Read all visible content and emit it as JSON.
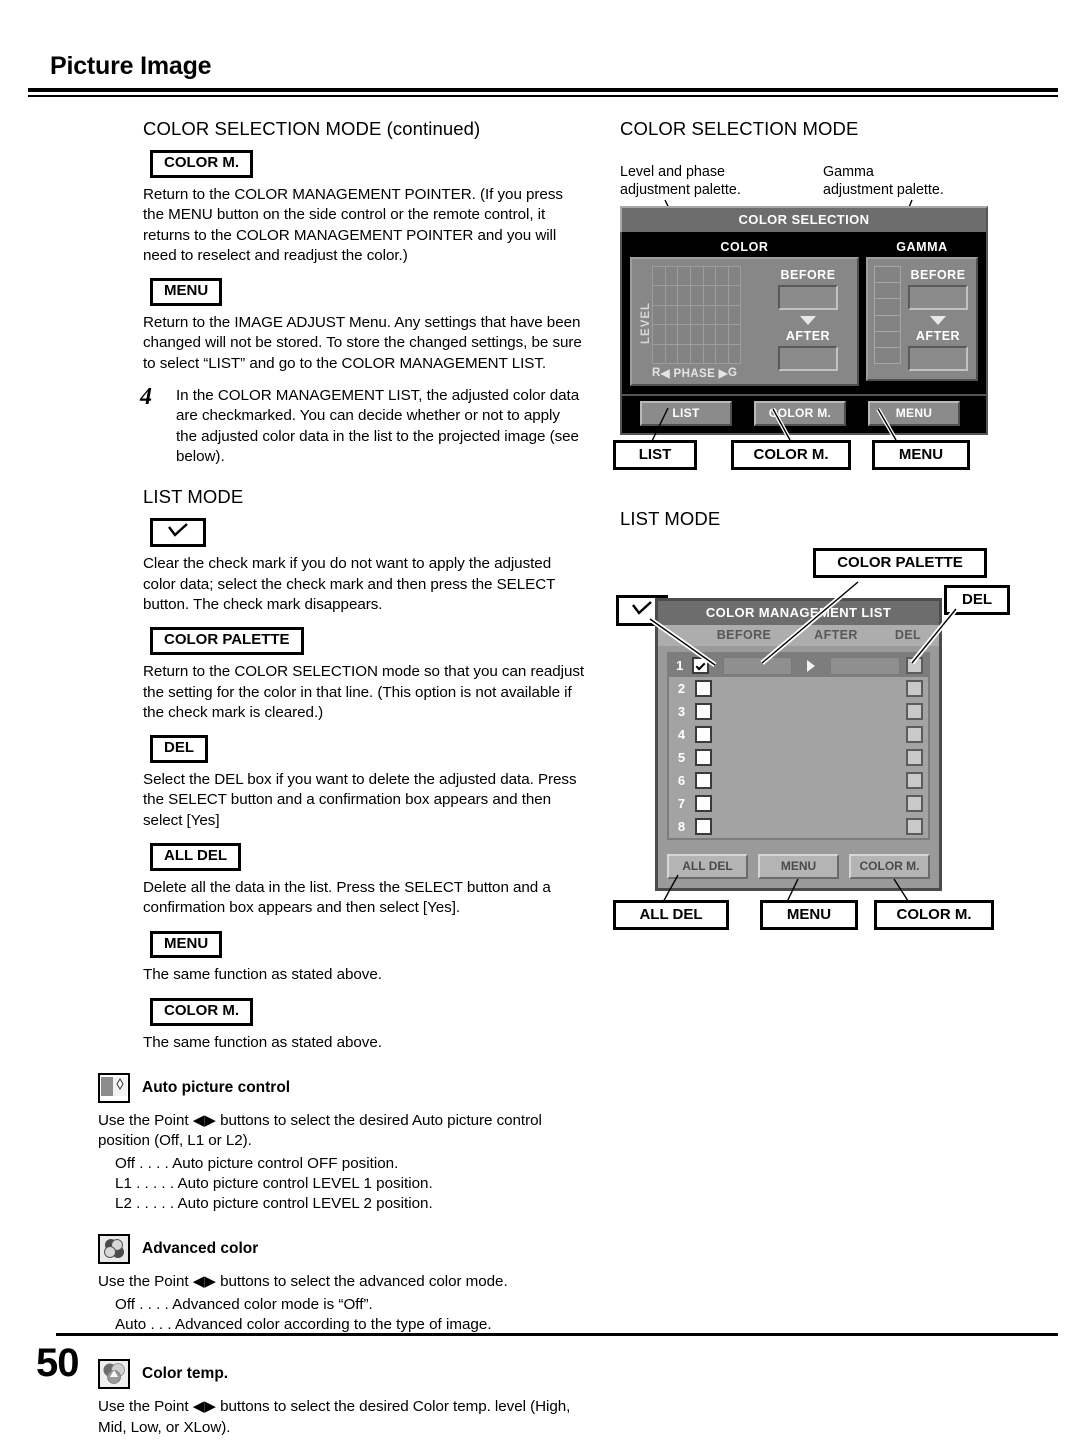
{
  "header": {
    "title": "Picture Image"
  },
  "footer": {
    "page_number": "50"
  },
  "left": {
    "section1_title": "COLOR SELECTION MODE (continued)",
    "color_m_label": "COLOR M.",
    "color_m_text": "Return to the COLOR MANAGEMENT POINTER. (If you press the MENU button on the side control or the remote control, it returns to the COLOR MANAGEMENT POINTER and you will need to reselect and readjust the color.)",
    "menu_label": "MENU",
    "menu_text": "Return to the IMAGE ADJUST Menu. Any settings that have been changed will not be stored. To store the changed settings, be sure to select “LIST” and go to the COLOR MANAGEMENT LIST.",
    "step_number": "4",
    "step_text": "In the COLOR MANAGEMENT LIST, the adjusted color data are checkmarked. You can decide whether or not to apply the adjusted color data in the list to the projected image (see below).",
    "list_mode_title": "LIST MODE",
    "check_label": "check-mark",
    "check_text": "Clear the check mark if you do not want to apply the adjusted color data; select the check mark and then press the SELECT button. The check mark disappears.",
    "color_palette_label": "COLOR PALETTE",
    "color_palette_text": "Return to the COLOR SELECTION mode so that you can readjust the setting for the color in that line. (This option is not available if the check mark is cleared.)",
    "del_label": "DEL",
    "del_text": "Select the DEL box if you want to delete the adjusted data. Press the SELECT button and a confirmation box appears and then select [Yes]",
    "all_del_label": "ALL DEL",
    "all_del_text": "Delete all the data in the list. Press the SELECT button and a confirmation box appears and then select [Yes].",
    "menu2_label": "MENU",
    "menu2_text": "The same function as stated above.",
    "color_m2_label": "COLOR M.",
    "color_m2_text": "The same function as stated above.",
    "features": [
      {
        "icon": "auto-picture-control-icon",
        "title": "Auto picture control",
        "text": "Use the Point ◀▶ buttons to select the desired Auto picture control position (Off, L1 or L2).",
        "options": [
          "Off  . . . .  Auto picture control OFF position.",
          "L1 . . . . .  Auto picture control LEVEL 1 position.",
          "L2 . . . . .  Auto picture control LEVEL 2 position."
        ]
      },
      {
        "icon": "advanced-color-icon",
        "title": "Advanced color",
        "text": "Use the Point ◀▶ buttons to select the advanced color mode.",
        "options": [
          "Off  . . . .  Advanced color mode is “Off”.",
          "Auto . . .  Advanced color according to the type of image."
        ]
      },
      {
        "icon": "color-temp-icon",
        "title": "Color temp.",
        "text": "Use the Point ◀▶ buttons to select the desired Color temp. level (High, Mid, Low, or XLow).",
        "options": []
      }
    ]
  },
  "right": {
    "section1_title": "COLOR SELECTION MODE",
    "annotation_left": "Level and phase\nadjustment palette.",
    "annotation_right": "Gamma\nadjustment palette.",
    "osd_color_selection": {
      "title": "COLOR SELECTION",
      "color_panel_label": "COLOR",
      "gamma_panel_label": "GAMMA",
      "level_axis_label": "LEVEL",
      "phase_axis_left": "R",
      "phase_axis_center": "◀ PHASE ▶",
      "phase_axis_right": "G",
      "before_label": "BEFORE",
      "after_label": "AFTER",
      "grid_cols": 7,
      "grid_rows": 5,
      "gamma_cells": 6,
      "buttons": [
        "LIST",
        "COLOR M.",
        "MENU"
      ]
    },
    "callouts_selection": [
      "LIST",
      "COLOR M.",
      "MENU"
    ],
    "section2_title": "LIST MODE",
    "callout_color_palette": "COLOR PALETTE",
    "callout_del": "DEL",
    "callout_check": "check-mark",
    "osd_list": {
      "title": "COLOR MANAGEMENT LIST",
      "columns": [
        "BEFORE",
        "AFTER",
        "DEL"
      ],
      "rows": [
        {
          "num": "1",
          "checked": true
        },
        {
          "num": "2",
          "checked": false
        },
        {
          "num": "3",
          "checked": false
        },
        {
          "num": "4",
          "checked": false
        },
        {
          "num": "5",
          "checked": false
        },
        {
          "num": "6",
          "checked": false
        },
        {
          "num": "7",
          "checked": false
        },
        {
          "num": "8",
          "checked": false
        }
      ],
      "buttons": [
        "ALL DEL",
        "MENU",
        "COLOR M."
      ]
    },
    "callouts_list": [
      "ALL DEL",
      "MENU",
      "COLOR M."
    ]
  },
  "colors": {
    "osd_title_bar": "#6d6d6d",
    "osd_panel": "#878787",
    "ink": "#000000"
  }
}
